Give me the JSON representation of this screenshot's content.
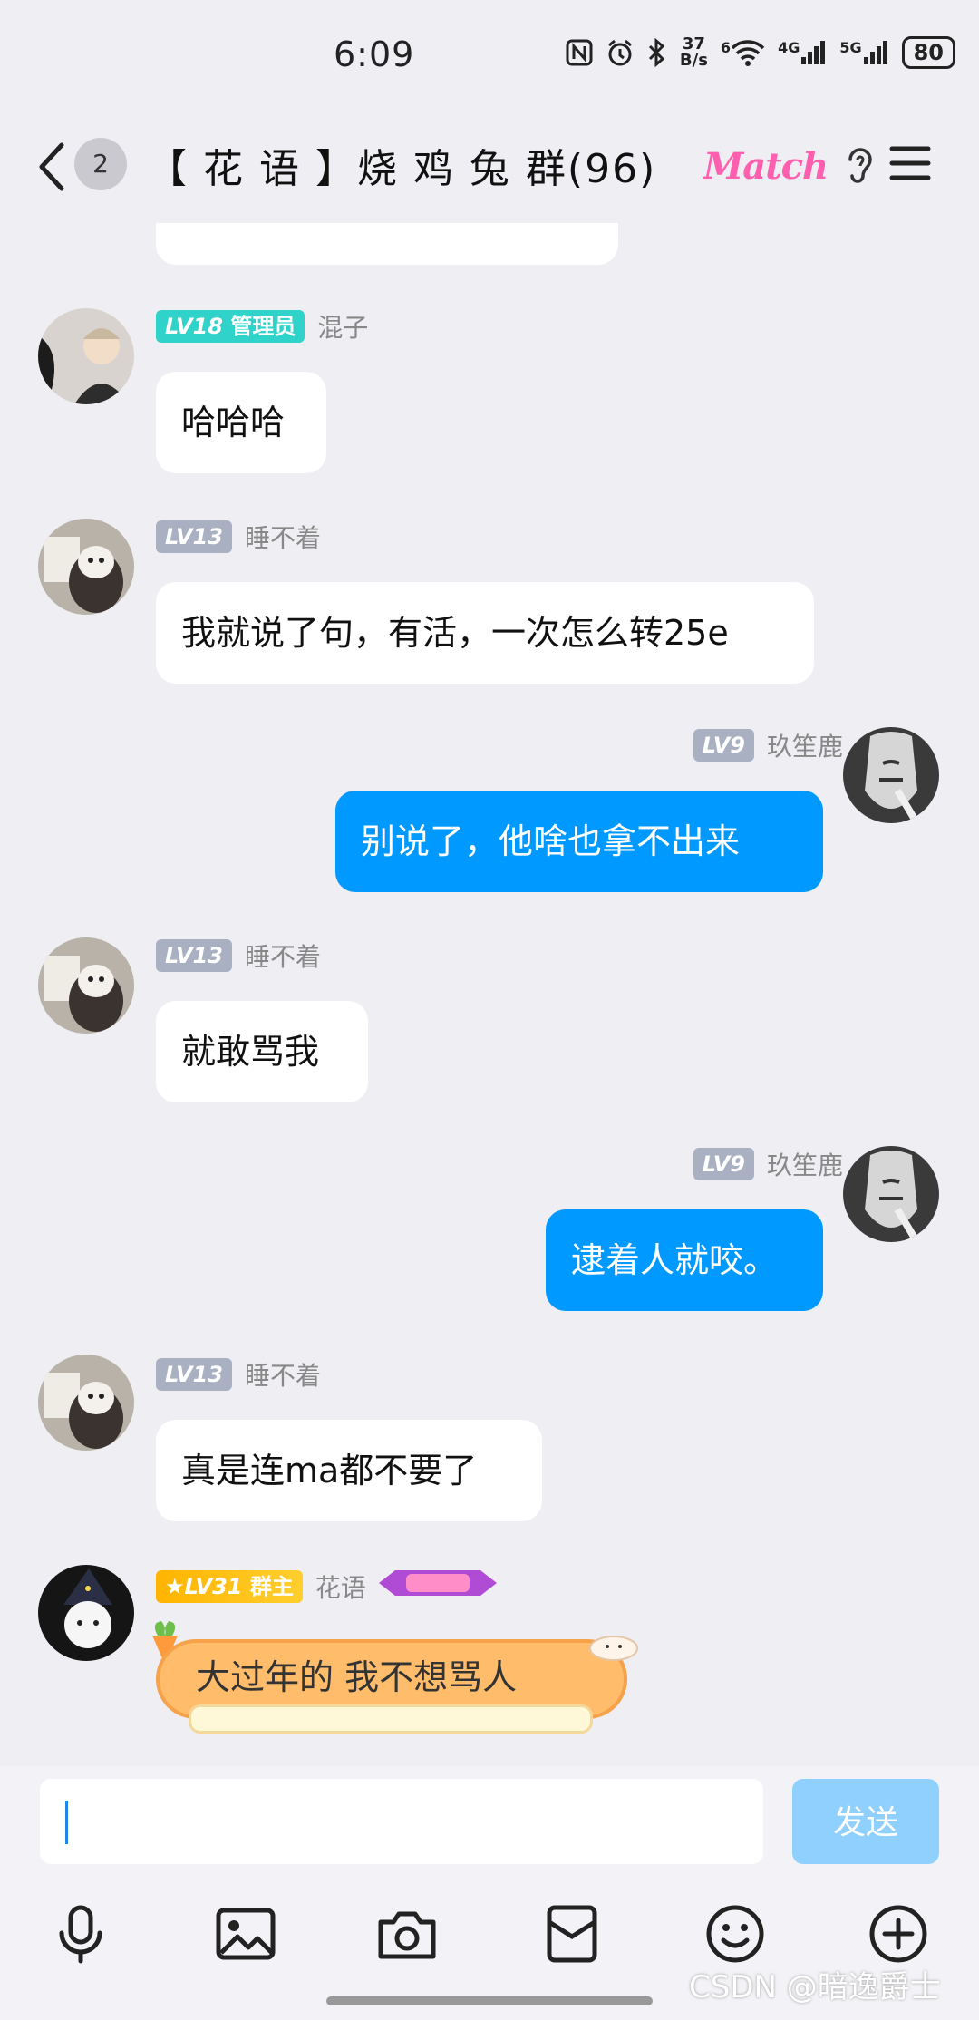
{
  "status": {
    "time": "6:09",
    "net_speed_value": "37",
    "net_speed_unit": "B/s",
    "signal_1": "4G",
    "signal_2": "5G",
    "wifi_num": "6",
    "battery": "80"
  },
  "header": {
    "unread_count": "2",
    "title": "【 花  语 】烧 鸡 兔 群(96)",
    "match_label": "Match"
  },
  "messages": [
    {
      "level": "LV18",
      "role": "管理员",
      "name": "混子",
      "text": "哈哈哈"
    },
    {
      "level": "LV13",
      "name": "睡不着",
      "text": "我就说了句，有活，一次怎么转25e"
    },
    {
      "level": "LV9",
      "name": "玖笙鹿",
      "text": "别说了，他啥也拿不出来"
    },
    {
      "level": "LV13",
      "name": "睡不着",
      "text": "就敢骂我"
    },
    {
      "level": "LV9",
      "name": "玖笙鹿",
      "text": "逮着人就咬。"
    },
    {
      "level": "LV13",
      "name": "睡不着",
      "text": "真是连ma都不要了"
    },
    {
      "level": "LV31",
      "role": "群主",
      "name": "花语",
      "text": "大过年的  我不想骂人"
    }
  ],
  "input": {
    "send_label": "发送"
  },
  "watermark": "CSDN @暗逸爵士",
  "colors": {
    "accent": "#0099ff",
    "send_disabled": "#8fd0ff",
    "bg": "#eeeef3"
  },
  "icons": [
    "back-icon",
    "ear-icon",
    "menu-icon",
    "mic-icon",
    "image-icon",
    "camera-icon",
    "red-packet-icon",
    "emoji-icon",
    "plus-icon"
  ]
}
